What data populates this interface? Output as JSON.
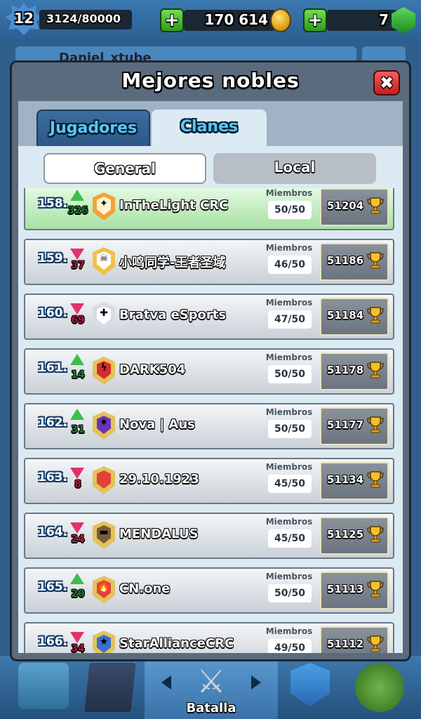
{
  "topbar": {
    "level": "12",
    "xp": "3124/80000",
    "gold": "170 614",
    "gems": "7",
    "add_gold_label": "+",
    "add_gems_label": "+"
  },
  "behind": {
    "player_name": "Daniel_xtube"
  },
  "panel": {
    "title": "Mejores nobles",
    "close_label": "✖",
    "tabs": [
      {
        "label": "Jugadores",
        "selected": false
      },
      {
        "label": "Clanes",
        "selected": true
      }
    ],
    "segments": [
      {
        "label": "General",
        "selected": true
      },
      {
        "label": "Local",
        "selected": false
      }
    ],
    "members_label": "Miembros",
    "rows": [
      {
        "rank": "158.",
        "trend": "up",
        "delta": "326",
        "name": "InTheLight CRC",
        "members": "50/50",
        "trophies": "51204",
        "badge_color": "#f2a23b",
        "badge_inner": "#fff3d0",
        "badge_symbol": "✦",
        "highlight": true
      },
      {
        "rank": "159.",
        "trend": "down",
        "delta": "37",
        "name": "小鸣同学-王者圣域",
        "members": "46/50",
        "trophies": "51186",
        "badge_color": "#f0c24a",
        "badge_inner": "#ffffff",
        "badge_symbol": "☠",
        "highlight": false
      },
      {
        "rank": "160.",
        "trend": "down",
        "delta": "69",
        "name": "Bratva eSports",
        "members": "47/50",
        "trophies": "51184",
        "badge_color": "#d7dde3",
        "badge_inner": "#ffffff",
        "badge_symbol": "✚",
        "highlight": false
      },
      {
        "rank": "161.",
        "trend": "up",
        "delta": "14",
        "name": "DARK504",
        "members": "50/50",
        "trophies": "51178",
        "badge_color": "#e3c35a",
        "badge_inner": "#d72b2b",
        "badge_symbol": "ϟ",
        "highlight": false
      },
      {
        "rank": "162.",
        "trend": "up",
        "delta": "31",
        "name": "Nova | Aus",
        "members": "50/50",
        "trophies": "51177",
        "badge_color": "#e3c35a",
        "badge_inner": "#6a34b8",
        "badge_symbol": "✷",
        "highlight": false
      },
      {
        "rank": "163.",
        "trend": "down",
        "delta": "8",
        "name": "29.10.1923",
        "members": "45/50",
        "trophies": "51134",
        "badge_color": "#e3c35a",
        "badge_inner": "#e0413a",
        "badge_symbol": "",
        "highlight": false
      },
      {
        "rank": "164.",
        "trend": "down",
        "delta": "24",
        "name": "MENDALUS",
        "members": "45/50",
        "trophies": "51125",
        "badge_color": "#e3c35a",
        "badge_inner": "#7a5a3a",
        "badge_symbol": "▬",
        "highlight": false
      },
      {
        "rank": "165.",
        "trend": "up",
        "delta": "20",
        "name": "CN.one",
        "members": "50/50",
        "trophies": "51113",
        "badge_color": "#e3c35a",
        "badge_inner": "#e0413a",
        "badge_symbol": "🔥",
        "highlight": false
      },
      {
        "rank": "166.",
        "trend": "down",
        "delta": "34",
        "name": "StarAllianceCRC",
        "members": "49/50",
        "trophies": "51112",
        "badge_color": "#e3c35a",
        "badge_inner": "#3a6fd0",
        "badge_symbol": "★",
        "highlight": false
      }
    ]
  },
  "bottomnav": {
    "battle_label": "Batalla"
  }
}
